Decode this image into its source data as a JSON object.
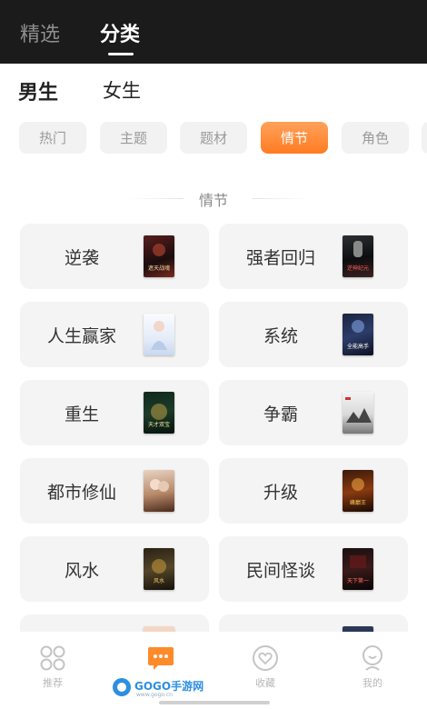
{
  "top_tabs": [
    "精选",
    "分类"
  ],
  "gender_tabs": [
    "男生",
    "女生"
  ],
  "chips": [
    "热门",
    "主题",
    "题材",
    "情节",
    "角色"
  ],
  "section_title": "情节",
  "categories": [
    "逆袭",
    "强者回归",
    "人生赢家",
    "系统",
    "重生",
    "争霸",
    "都市修仙",
    "升级",
    "风水",
    "民间怪谈"
  ],
  "cover_titles": [
    "遮天战魂",
    "逆神纪元",
    "",
    "全能高手",
    "天才双宝",
    "",
    "",
    "峰巅王",
    "风水",
    "天下第一"
  ],
  "bottom_tabs": [
    "推荐",
    "",
    "收藏",
    "我的"
  ],
  "watermark": {
    "text": "GOGO手游网",
    "sub": "www.gogo.cn"
  },
  "colors": {
    "accent": "#ff8a2a",
    "topbar": "#1b1b1b",
    "card": "#f4f4f4"
  }
}
